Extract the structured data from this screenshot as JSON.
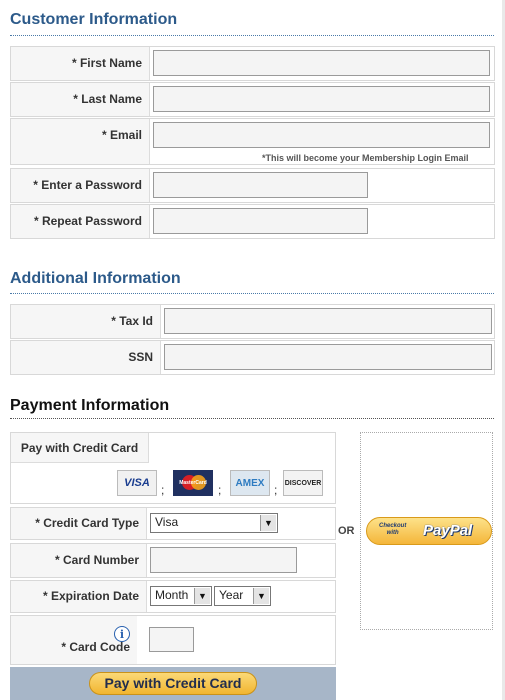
{
  "customer": {
    "title": "Customer Information",
    "first_name_label": "* First Name",
    "last_name_label": "* Last Name",
    "email_label": "* Email",
    "email_note": "*This will become your Membership Login Email",
    "password_label": "* Enter a Password",
    "repeat_password_label": "* Repeat Password"
  },
  "additional": {
    "title": "Additional Information",
    "tax_id_label": "* Tax Id",
    "ssn_label": "SSN"
  },
  "payment": {
    "title": "Payment Information",
    "pay_with_cc_label": "Pay with Credit Card",
    "cards": [
      {
        "name": "visa-card-icon",
        "text": "VISA"
      },
      {
        "name": "mastercard-card-icon",
        "text": "MasterCard"
      },
      {
        "name": "amex-card-icon",
        "text": "AMEX"
      },
      {
        "name": "discover-card-icon",
        "text": "DISCOVER"
      }
    ],
    "separator": ";",
    "card_type_label": "* Credit Card Type",
    "card_type_value": "Visa",
    "card_number_label": "* Card Number",
    "expiration_label": "* Expiration Date",
    "month_value": "Month",
    "year_value": "Year",
    "card_code_label": "* Card Code",
    "info_icon_text": "i",
    "or_text": "OR",
    "paypal_checkout_text": "Checkout",
    "paypal_with_text": "with",
    "paypal_brand": "PayPal",
    "submit_label": "Pay with Credit Card"
  },
  "colors": {
    "section_blue": "#2c5a8a",
    "button_gold": "#f5c243",
    "footer_bar": "#a7b6c8"
  }
}
